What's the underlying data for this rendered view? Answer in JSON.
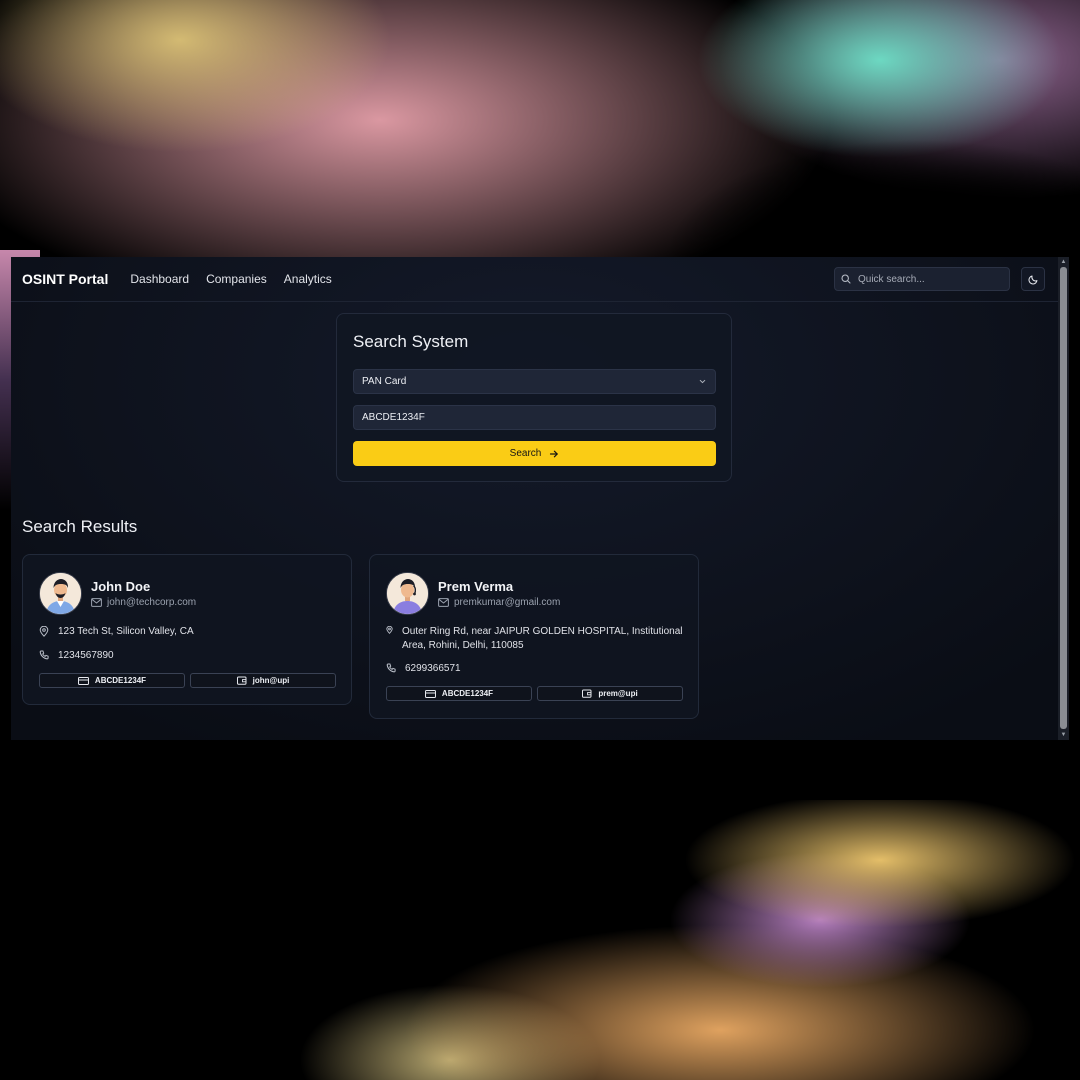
{
  "app": {
    "brand": "OSINT Portal",
    "nav": [
      "Dashboard",
      "Companies",
      "Analytics"
    ],
    "quick_search_placeholder": "Quick search...",
    "accent_color": "#facc15"
  },
  "search": {
    "title": "Search System",
    "type_selected": "PAN Card",
    "query_value": "ABCDE1234F",
    "button_label": "Search"
  },
  "results": {
    "title": "Search Results",
    "items": [
      {
        "name": "John Doe",
        "email": "john@techcorp.com",
        "address": "123 Tech St, Silicon Valley, CA",
        "phone": "1234567890",
        "pan": "ABCDE1234F",
        "upi": "john@upi"
      },
      {
        "name": "Prem Verma",
        "email": "premkumar@gmail.com",
        "address": "Outer Ring Rd, near JAIPUR GOLDEN HOSPITAL, Institutional Area, Rohini, Delhi, 110085",
        "phone": "6299366571",
        "pan": "ABCDE1234F",
        "upi": "prem@upi"
      }
    ]
  }
}
